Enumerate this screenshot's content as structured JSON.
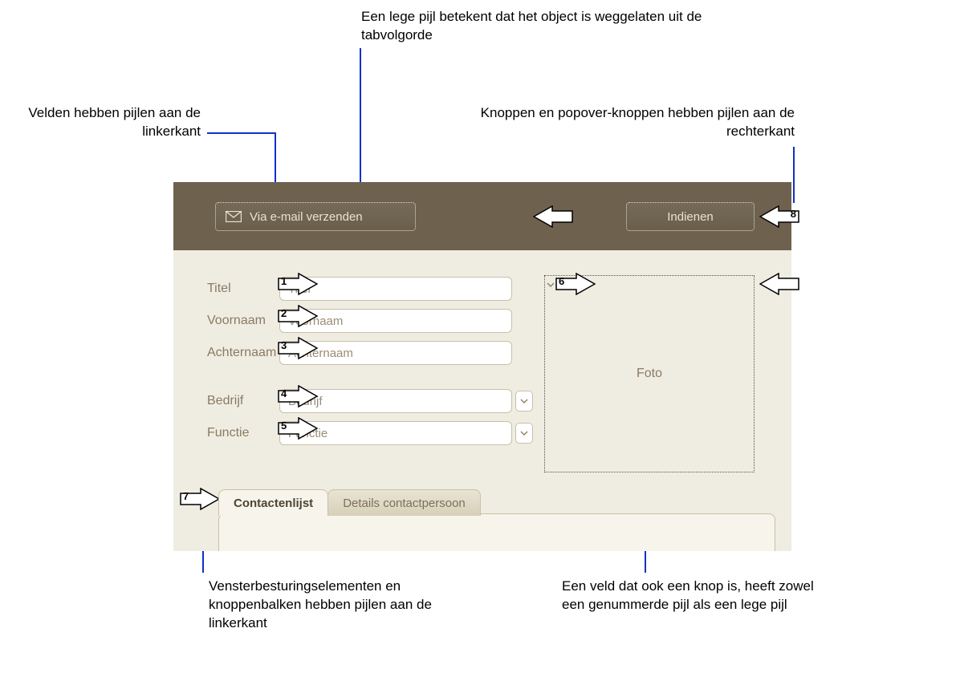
{
  "callouts": {
    "top_center": "Een lege pijl betekent dat het object is weggelaten uit de tabvolgorde",
    "top_left": "Velden hebben pijlen aan de linkerkant",
    "top_right": "Knoppen en popover-knoppen hebben pijlen aan de rechterkant",
    "bottom_left": "Vensterbesturingselementen en knoppenbalken hebben pijlen aan de linkerkant",
    "bottom_right": "Een veld dat ook een knop is, heeft zowel een genummerde pijl als een lege pijl"
  },
  "header": {
    "email_button": "Via e-mail verzenden",
    "submit_button": "Indienen"
  },
  "fields": {
    "title": {
      "label": "Titel",
      "placeholder": "Titel",
      "tab": "1"
    },
    "firstname": {
      "label": "Voornaam",
      "placeholder": "Voornaam",
      "tab": "2"
    },
    "lastname": {
      "label": "Achternaam",
      "placeholder": "Achternaam",
      "tab": "3"
    },
    "company": {
      "label": "Bedrijf",
      "placeholder": "Bedrijf",
      "tab": "4"
    },
    "jobtitle": {
      "label": "Functie",
      "placeholder": "Functie",
      "tab": "5"
    }
  },
  "photo": {
    "label": "Foto",
    "tab": "6"
  },
  "tabs": {
    "contacts": {
      "label": "Contactenlijst",
      "tab": "7"
    },
    "details": {
      "label": "Details contactpersoon"
    }
  },
  "submit_tab": "8"
}
